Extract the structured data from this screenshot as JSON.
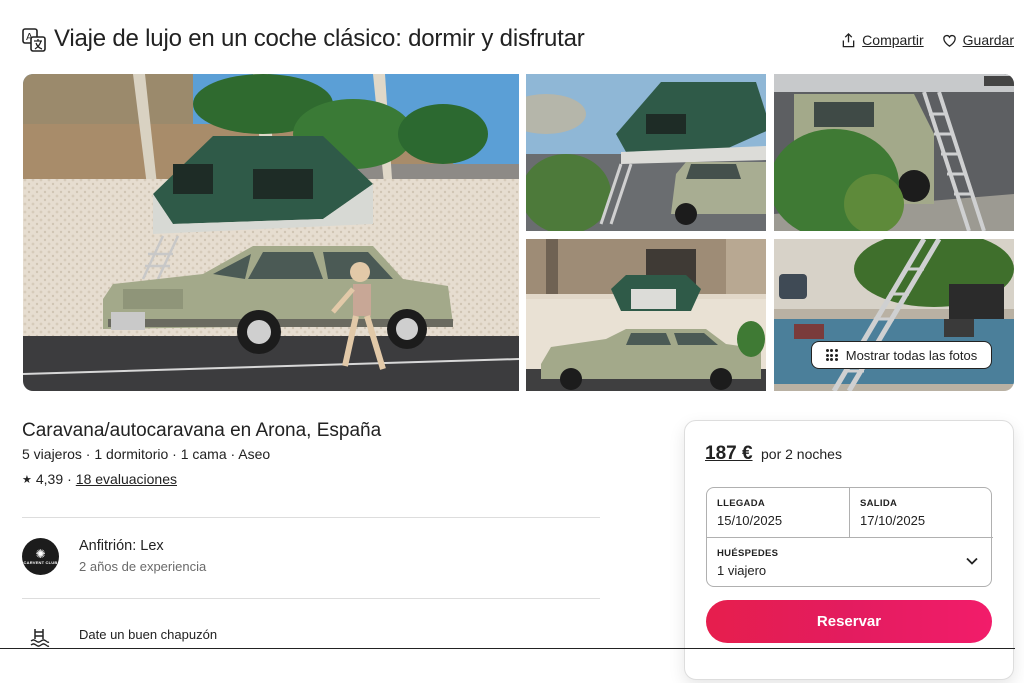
{
  "header": {
    "title": "Viaje de lujo en un coche clásico: dormir y disfrutar",
    "share_label": "Compartir",
    "save_label": "Guardar"
  },
  "gallery": {
    "show_all_label": "Mostrar todas las fotos"
  },
  "listing": {
    "title": "Caravana/autocaravana en Arona, España",
    "details": "5 viajeros · 1 dormitorio · 1 cama · Aseo",
    "rating": "4,39",
    "rating_separator": "·",
    "reviews": "18 evaluaciones"
  },
  "host": {
    "name": "Anfitrión: Lex",
    "experience": "2 años de experiencia",
    "avatar_text": "CARVENT CLUB"
  },
  "amenity": {
    "label": "Date un buen chapuzón"
  },
  "booking": {
    "price": "187 €",
    "nights": "por 2 noches",
    "checkin_label": "LLEGADA",
    "checkin_value": "15/10/2025",
    "checkout_label": "SALIDA",
    "checkout_value": "17/10/2025",
    "guests_label": "HUÉSPEDES",
    "guests_value": "1 viajero",
    "reserve_label": "Reservar"
  },
  "colors": {
    "accent": "#e31c5f",
    "text": "#222222",
    "muted": "#6a6a6a",
    "border": "#dddddd",
    "tent": "#2f5a48",
    "car": "#a3a98a"
  }
}
